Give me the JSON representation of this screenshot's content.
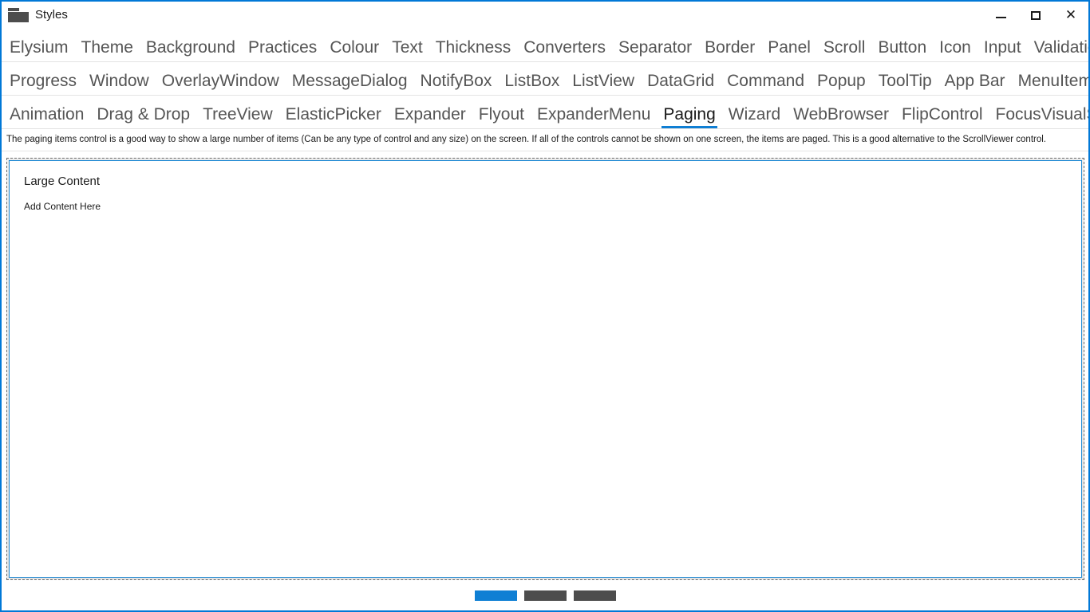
{
  "window": {
    "title": "Styles",
    "icon": "folder-icon",
    "border_color": "#0078D7",
    "controls": {
      "minimize": "minimize-icon",
      "maximize": "maximize-icon",
      "close": "✕"
    }
  },
  "tabs": {
    "selected": "Paging",
    "accent_color": "#0f7fd4",
    "rows": [
      {
        "items": [
          {
            "label": "Elysium"
          },
          {
            "label": "Theme"
          },
          {
            "label": "Background"
          },
          {
            "label": "Practices"
          },
          {
            "label": "Colour"
          },
          {
            "label": "Text"
          },
          {
            "label": "Thickness"
          },
          {
            "label": "Converters"
          },
          {
            "label": "Separator"
          },
          {
            "label": "Border"
          },
          {
            "label": "Panel"
          },
          {
            "label": "Scroll"
          },
          {
            "label": "Button"
          },
          {
            "label": "Icon"
          },
          {
            "label": "Input"
          },
          {
            "label": "Validation"
          }
        ]
      },
      {
        "items": [
          {
            "label": "Progress"
          },
          {
            "label": "Window"
          },
          {
            "label": "OverlayWindow"
          },
          {
            "label": "MessageDialog"
          },
          {
            "label": "NotifyBox"
          },
          {
            "label": "ListBox"
          },
          {
            "label": "ListView"
          },
          {
            "label": "DataGrid"
          },
          {
            "label": "Command"
          },
          {
            "label": "Popup"
          },
          {
            "label": "ToolTip"
          },
          {
            "label": "App Bar"
          },
          {
            "label": "MenuItem"
          }
        ]
      },
      {
        "items": [
          {
            "label": "Animation"
          },
          {
            "label": "Drag & Drop"
          },
          {
            "label": "TreeView"
          },
          {
            "label": "ElasticPicker"
          },
          {
            "label": "Expander"
          },
          {
            "label": "Flyout"
          },
          {
            "label": "ExpanderMenu"
          },
          {
            "label": "Paging"
          },
          {
            "label": "Wizard"
          },
          {
            "label": "WebBrowser"
          },
          {
            "label": "FlipControl"
          },
          {
            "label": "FocusVisualStyle"
          }
        ]
      }
    ]
  },
  "description": "The paging items control is a good way to show a large number of items (Can be any type of control and any size) on the screen. If all of the controls cannot be shown on one screen, the items are paged. This is a good alternative to the ScrollViewer control.",
  "paging": {
    "page_title": "Large Content",
    "page_body": "Add Content Here",
    "indicator": {
      "count": 3,
      "active_index": 0,
      "active_color": "#0f7fd4",
      "inactive_color": "#4d4d4d"
    }
  }
}
